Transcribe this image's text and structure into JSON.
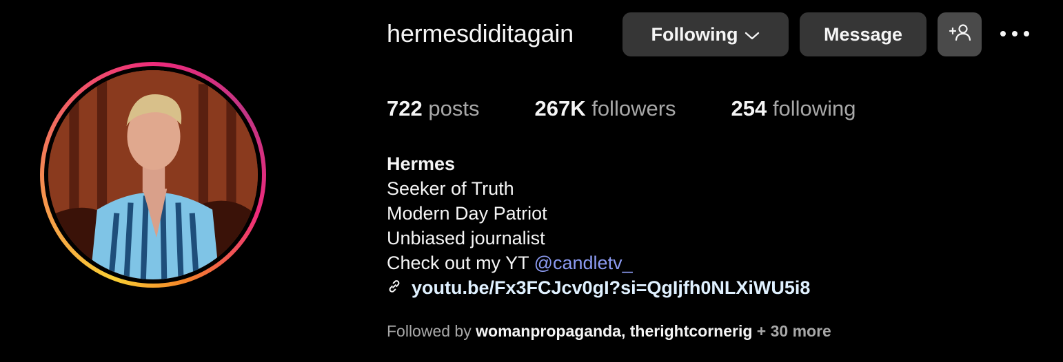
{
  "profile": {
    "username": "hermesdiditagain",
    "avatar_alt": "profile-photo"
  },
  "actions": {
    "following_label": "Following",
    "message_label": "Message",
    "add_user_icon": "add-user-icon",
    "more_icon": "more-options-icon"
  },
  "stats": {
    "posts_count": "722",
    "posts_label": "posts",
    "followers_count": "267K",
    "followers_label": "followers",
    "following_count": "254",
    "following_label": "following"
  },
  "bio": {
    "name": "Hermes",
    "lines": [
      "Seeker of Truth",
      "Modern Day Patriot",
      "Unbiased journalist"
    ],
    "cta_text": "Check out my YT ",
    "mention": "@candletv_",
    "link": "youtu.be/Fx3FCJcv0gI?si=QgIjfh0NLXiWU5i8"
  },
  "followed_by": {
    "prefix": "Followed by ",
    "accounts": [
      "womanpropaganda",
      "therightcornerig"
    ],
    "separator": ", ",
    "more": " + 30 more"
  },
  "colors": {
    "background": "#000000",
    "button": "#363636",
    "mention": "#8c9bf2",
    "link": "#e0f1ff"
  }
}
